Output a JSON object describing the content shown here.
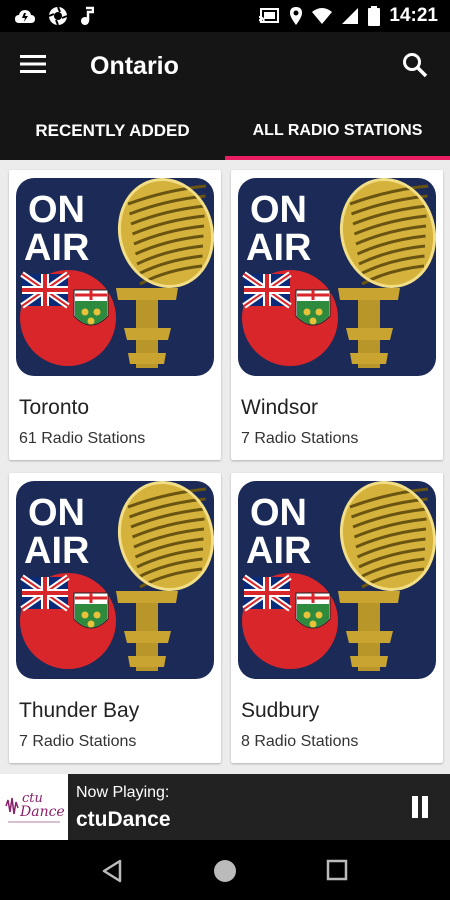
{
  "status_bar": {
    "time": "14:21",
    "left_icons": [
      "cloud-icon",
      "aperture-icon",
      "music-note-icon"
    ],
    "right_icons": [
      "cast-icon",
      "location-icon",
      "wifi-icon",
      "signal-icon",
      "battery-icon"
    ]
  },
  "app_bar": {
    "title": "Ontario",
    "menu_icon": "hamburger-menu-icon",
    "search_icon": "search-icon"
  },
  "tabs": [
    {
      "label": "RECENTLY ADDED",
      "active": false
    },
    {
      "label": "ALL RADIO STATIONS",
      "active": true
    }
  ],
  "accent_color": "#e91e63",
  "thumbnail": {
    "text_line1": "ON",
    "text_line2": "AIR",
    "background_color": "#1b2a57",
    "microphone_color": "#d4b23c",
    "flag_circle_color": "#d9262b"
  },
  "cities": [
    {
      "name": "Toronto",
      "count": "61 Radio Stations"
    },
    {
      "name": "Windsor",
      "count": "7 Radio Stations"
    },
    {
      "name": "Thunder Bay",
      "count": "7 Radio Stations"
    },
    {
      "name": "Sudbury",
      "count": "8 Radio Stations"
    }
  ],
  "now_playing": {
    "label": "Now Playing:",
    "station": "ctuDance",
    "logo_text_top": "ctu",
    "logo_text_bottom": "Dance",
    "pause_icon": "pause-icon"
  },
  "nav_bar": {
    "icons": [
      "back-icon",
      "home-icon",
      "recents-icon"
    ]
  }
}
